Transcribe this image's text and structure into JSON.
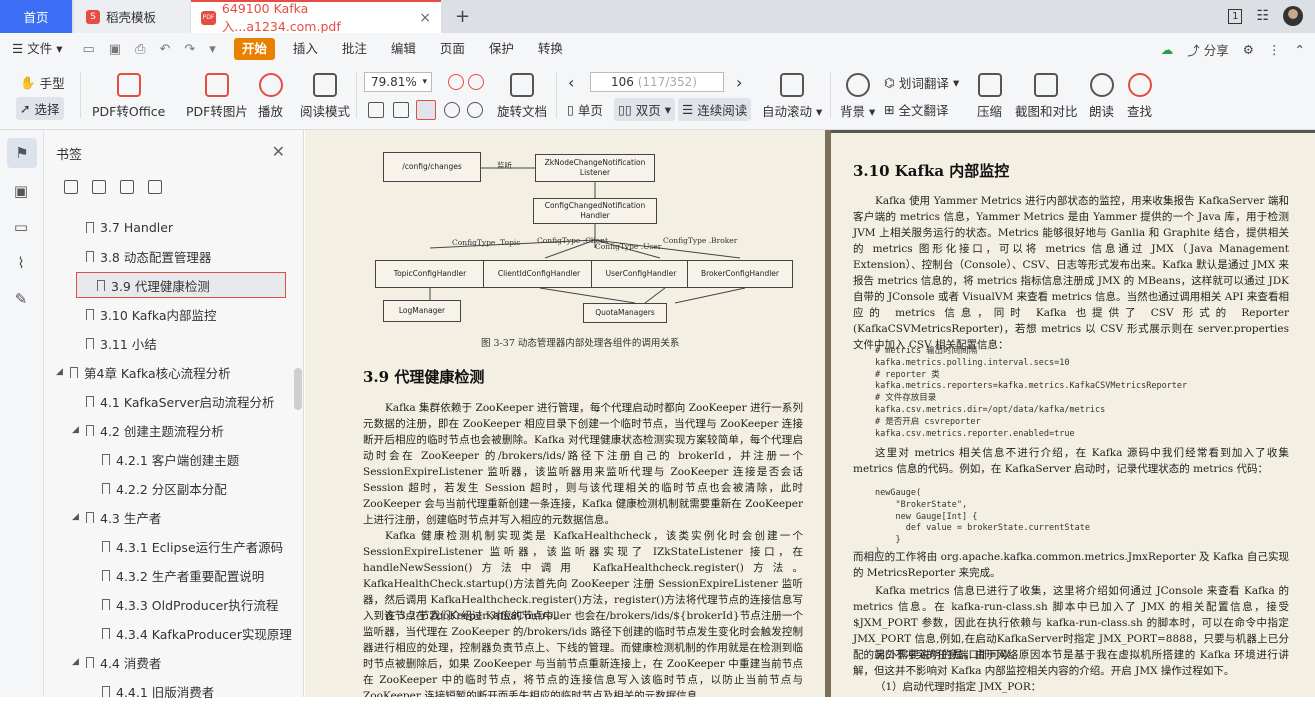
{
  "tabs": {
    "home": "首页",
    "daoke": "稻壳模板",
    "doc": "649100 Kafka入...a1234.com.pdf",
    "doc_icon": "PDF",
    "close": "×",
    "new": "+"
  },
  "window": {
    "badge": "1"
  },
  "menu": {
    "file": "文件",
    "items": [
      "开始",
      "插入",
      "批注",
      "编辑",
      "页面",
      "保护",
      "转换"
    ],
    "share": "分享"
  },
  "toolbar": {
    "hand": "手型",
    "select": "选择",
    "pdf2office": "PDF转Office",
    "pdf2img": "PDF转图片",
    "play": "播放",
    "readmode": "阅读模式",
    "zoom": "79.81%",
    "page_cur": "106",
    "page_total": "(117/352)",
    "rotate": "旋转文档",
    "single": "单页",
    "double": "双页",
    "continuous": "连续阅读",
    "autoscroll": "自动滚动",
    "bg": "背景",
    "wordtrans": "划词翻译",
    "fulltrans": "全文翻译",
    "compress": "压缩",
    "compare": "截图和对比",
    "read": "朗读",
    "find": "查找"
  },
  "bookmarks": {
    "title": "书签",
    "items": [
      {
        "label": "3.7 Handler",
        "indent": 2,
        "tri": ""
      },
      {
        "label": "3.8 动态配置管理器",
        "indent": 2,
        "tri": ""
      },
      {
        "label": "3.9 代理健康检测",
        "indent": 2,
        "tri": "",
        "selected": true
      },
      {
        "label": "3.10 Kafka内部监控",
        "indent": 2,
        "tri": ""
      },
      {
        "label": "3.11 小结",
        "indent": 2,
        "tri": ""
      },
      {
        "label": "第4章 Kafka核心流程分析",
        "indent": 1,
        "tri": "◢"
      },
      {
        "label": "4.1 KafkaServer启动流程分析",
        "indent": 2,
        "tri": ""
      },
      {
        "label": "4.2 创建主题流程分析",
        "indent": 2,
        "tri": "◢"
      },
      {
        "label": "4.2.1 客户端创建主题",
        "indent": 3,
        "tri": ""
      },
      {
        "label": "4.2.2 分区副本分配",
        "indent": 3,
        "tri": ""
      },
      {
        "label": "4.3 生产者",
        "indent": 2,
        "tri": "◢"
      },
      {
        "label": "4.3.1 Eclipse运行生产者源码",
        "indent": 3,
        "tri": ""
      },
      {
        "label": "4.3.2 生产者重要配置说明",
        "indent": 3,
        "tri": ""
      },
      {
        "label": "4.3.3 OldProducer执行流程",
        "indent": 3,
        "tri": ""
      },
      {
        "label": "4.3.4 KafkaProducer实现原理",
        "indent": 3,
        "tri": ""
      },
      {
        "label": "4.4 消费者",
        "indent": 2,
        "tri": "◢"
      },
      {
        "label": "4.4.1 旧版消费者",
        "indent": 3,
        "tri": ""
      }
    ]
  },
  "diagram": {
    "config_changes": "/config/changes",
    "listen": "监听",
    "zk_notif": "ZkNodeChangeNotification Listener",
    "cc_handler": "ConfigChangedNotification Handler",
    "ct_topic": "ConfigType .Topic",
    "ct_client": "ConfigType .Client",
    "ct_user": "ConfigType .User",
    "ct_broker": "ConfigType .Broker",
    "topic_h": "TopicConfigHandler",
    "client_h": "ClientIdConfigHandler",
    "user_h": "UserConfigHandler",
    "broker_h": "BrokerConfigHandler",
    "logm": "LogManager",
    "quota": "QuotaManagers",
    "caption": "图 3-37   动态管理器内部处理各组件的调用关系"
  },
  "left_page": {
    "heading": "3.9   代理健康检测",
    "p1": "Kafka 集群依赖于 ZooKeeper 进行管理，每个代理启动时都向 ZooKeeper 进行一系列元数据的注册，即在 ZooKeeper 相应目录下创建一个临时节点，当代理与 ZooKeeper 连接断开后相应的临时节点也会被删除。Kafka 对代理健康状态检测实现方案较简单，每个代理启动时会在 ZooKeeper 的/brokers/ids/路径下注册自己的 brokerId，并注册一个 SessionExpireListener 监听器，该监听器用来监听代理与 ZooKeeper 连接是否会话 Session 超时，若发生 Session 超时，则与该代理相关的临时节点也会被清除，此时 ZooKeeper 会与当前代理重新创建一条连接，Kafka 健康检测机制就需要重新在 ZooKeeper 上进行注册，创建临时节点并写入相应的元数据信息。",
    "p2": "Kafka 健康检测机制实现类是 KafkaHealthcheck，该类实例化时会创建一个 SessionExpireListener 监听器，该监听器实现了 IZkStateListener 接口，在 handleNewSession()方法中调用 KafkaHealthcheck.register()方法。KafkaHealthCheck.startup()方法首先向 ZooKeeper 注册 SessionExpireListener 监听器，然后调用 KafkaHealthcheck.register()方法，register()方法将代理节点的连接信息写入到该节点在 ZooKeeper 对应的节点中。",
    "p3": "在 3.2 节我们介绍过 KafkaController 也会在/brokers/ids/${brokerId}节点注册一个监听器，当代理在 ZooKeeper 的/brokers/ids 路径下创建的临时节点发生变化时会触发控制器进行相应的处理，控制器负责节点上、下线的管理。而健康检测机制的作用就是在检测到临时节点被删除后，如果 ZooKeeper 与当前节点重新连接上，在 ZooKeeper 中重建当前节点在 ZooKeeper 中的临时节点，将节点的连接信息写入该临时节点，以防止当前节点与 ZooKeeper 连接短暂的断开而丢失相应的临时节点及相关的元数据信息。"
  },
  "right_page": {
    "heading": "3.10   Kafka 内部监控",
    "p1": "Kafka 使用 Yammer Metrics 进行内部状态的监控，用来收集报告 KafkaServer 端和客户端的 metrics 信息，Yammer Metrics 是由 Yammer 提供的一个 Java 库，用于检测 JVM 上相关服务运行的状态。Metrics 能够很好地与 Ganlia 和 Graphite 结合，提供相关的 metrics 图形化接口，可以将 metrics 信息通过 JMX（Java Management Extension）、控制台（Console）、CSV、日志等形式发布出来。Kafka 默认是通过 JMX 来报告 metrics 信息的，将 metrics 指标信息注册成 JMX 的 MBeans，这样就可以通过 JDK 自带的 JConsole 或者 VisualVM 来查看 metrics 信息。当然也通过调用相关 API 来查看相应的 metrics 信息，同时 Kafka 也提供了 CSV 形式的 Reporter (KafkaCSVMetricsReporter)，若想 metrics 以 CSV 形式展示则在 server.properties 文件中加入 CSV 相关配置信息：",
    "code1": "# metrics 输出时间间隔\nkafka.metrics.polling.interval.secs=10\n# reporter 类\nkafka.metrics.reporters=kafka.metrics.KafkaCSVMetricsReporter\n# 文件存放目录\nkafka.csv.metrics.dir=/opt/data/kafka/metrics\n# 是否开启 csvreporter\nkafka.csv.metrics.reporter.enabled=true",
    "p2": "这里对 metrics 相关信息不进行介绍，在 Kafka 源码中我们经常看到加入了收集 metrics 信息的代码。例如，在 KafkaServer 启动时，记录代理状态的 metrics 代码：",
    "code2": "newGauge(\n    \"BrokerState\",\n    new Gauge[Int] {\n      def value = brokerState.currentState\n    }\n)",
    "p3": "而相应的工作将由 org.apache.kafka.common.metrics.JmxReporter 及 Kafka 自己实现的 MetricsReporter 来完成。",
    "p4": "Kafka metrics 信息已进行了收集，这里将介绍如何通过 JConsole 来查看 Kafka 的 metrics 信息。在 kafka-run-class.sh 脚本中已加入了 JMX 的相关配置信息，接受$JXM_PORT 参数，因此在执行依赖与 kafka-run-class.sh 的脚本时，可以在命令中指定JMX_PORT 信息,例如,在启动KafkaServer时指定 JMX_PORT=8888，只要与机器上已分配的端口不冲突的任意端口即可以。",
    "p5": "另外需要说明的是，由于网络原因本节是基于我在虚拟机所搭建的 Kafka 环境进行讲解，但这并不影响对 Kafka 内部监控相关内容的介绍。开启 JMX 操作过程如下。",
    "p6": "（1）启动代理时指定 JMX_POR："
  }
}
